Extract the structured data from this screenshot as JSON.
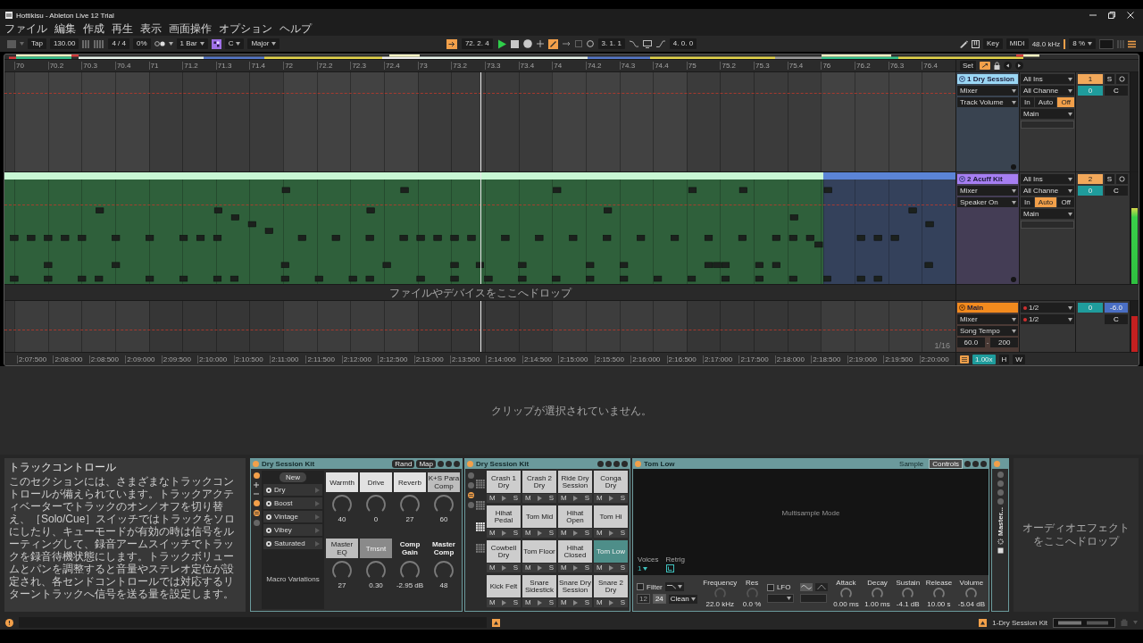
{
  "title_bar": {
    "title": "Hottikisu - Ableton Live 12 Trial"
  },
  "menu": [
    "ファイル",
    "編集",
    "作成",
    "再生",
    "表示",
    "画面操作",
    "オプション",
    "ヘルプ"
  ],
  "control_bar": {
    "tap": "Tap",
    "tempo": "130.00",
    "signature": "4 / 4",
    "groove": "0%",
    "quantize": "1 Bar",
    "key": "C",
    "scale": "Major",
    "position": "72. 2. 4",
    "playing": true,
    "loop_start": "3. 1. 1",
    "loop_length": "4. 0. 0",
    "key_map": "Key",
    "midi_map": "MIDI",
    "sample_rate": "48.0 kHz",
    "cpu": "8 %"
  },
  "ruler": {
    "bars": [
      "70",
      "70.2",
      "70.3",
      "70.4",
      "71",
      "71.2",
      "71.3",
      "71.4",
      "72",
      "72.2",
      "72.3",
      "72.4",
      "73",
      "73.2",
      "73.3",
      "73.4",
      "74",
      "74.2",
      "74.3",
      "74.4",
      "75",
      "75.2",
      "75.3",
      "75.4",
      "76",
      "76.2",
      "76.3",
      "76.4"
    ],
    "set": "Set"
  },
  "tracks": [
    {
      "name": "1 Dry Session",
      "color": "#9ad6f4",
      "device": "Mixer",
      "control": "Track Volume",
      "input": "All Ins",
      "channel": "All Channe",
      "monitor": [
        {
          "label": "In",
          "selected": false
        },
        {
          "label": "Auto",
          "selected": false
        },
        {
          "label": "Off",
          "selected": true
        }
      ],
      "output": "Main",
      "number": "1",
      "solo": "S",
      "volume": "0",
      "pan": "C"
    },
    {
      "name": "2 Acuff Kit",
      "color": "#a67ef2",
      "device": "Mixer",
      "control": "Speaker On",
      "input": "All Ins",
      "channel": "All Channe",
      "monitor": [
        {
          "label": "In",
          "selected": false
        },
        {
          "label": "Auto",
          "selected": true
        },
        {
          "label": "Off",
          "selected": false
        }
      ],
      "output": "Main",
      "number": "2",
      "solo": "S",
      "volume": "0",
      "pan": "C",
      "meter": {
        "level": 0.68
      },
      "clips": [
        {
          "color": "#c8f7d4"
        },
        {
          "color": "#5b84d6"
        }
      ]
    }
  ],
  "drop_zone": {
    "text": "ファイルやデバイスをここへドロップ"
  },
  "main_track": {
    "name": "Main",
    "device": "Mixer",
    "control": "Song Tempo",
    "range_min": "60.0",
    "range_sep": "-",
    "range_max": "200",
    "outputs": [
      "1/2",
      "1/2"
    ],
    "volume": "0",
    "cue": "-6.0",
    "pan": "C",
    "meter": {
      "level": 0.7
    }
  },
  "arrangement_footer": {
    "grid": "1/16",
    "times": [
      "2:07:500",
      "2:08:000",
      "2:08:500",
      "2:09:000",
      "2:09:500",
      "2:10:000",
      "2:10:500",
      "2:11:000",
      "2:11:500",
      "2:12:000",
      "2:12:500",
      "2:13:000",
      "2:13:500",
      "2:14:000",
      "2:14:500",
      "2:15:000",
      "2:15:500",
      "2:16:000",
      "2:16:500",
      "2:17:000",
      "2:17:500",
      "2:18:000",
      "2:18:500",
      "2:19:000",
      "2:19:500",
      "2:20:000"
    ],
    "zoom": "1.00x",
    "fit_height": "H",
    "fit_width": "W"
  },
  "detail_view": {
    "message": "クリップが選択されていません。"
  },
  "info_view": {
    "title": "トラックコントロール",
    "text": "このセクションには、さまざまなトラックコントロールが備えられています。トラックアクティベーターでトラックのオン／オフを切り替え、［Solo/Cue］スイッチではトラックをソロにしたり、キューモードが有効の時は信号をルーティングして、録音アームスイッチでトラックを録音待機状態にします。トラックボリュームとパンを調整すると音量やステレオ定位が設定され、各センドコントロールでは対応するリターントラックへ信号を送る量を設定します。"
  },
  "devices": {
    "macro_rack": {
      "name": "Dry Session Kit",
      "buttons": [
        "Rand",
        "Map"
      ],
      "new_label": "New",
      "variations": [
        "Dry",
        "Boost",
        "Vintage",
        "Vibey",
        "Saturated"
      ],
      "variations_label": "Macro Variations",
      "macros": [
        {
          "label": "Warmth",
          "value": "40",
          "kind": "light"
        },
        {
          "label": "Drive",
          "value": "0",
          "kind": "light"
        },
        {
          "label": "Reverb",
          "value": "27",
          "kind": "light"
        },
        {
          "label": "K+S Para Comp",
          "value": "60",
          "kind": "mid"
        },
        {
          "label": "Master EQ",
          "value": "27",
          "kind": "mid"
        },
        {
          "label": "Trnsnt",
          "value": "0.30",
          "kind": "dim"
        },
        {
          "label": "Comp Gain",
          "value": "-2.95 dB",
          "kind": "plain"
        },
        {
          "label": "Master Comp",
          "value": "48",
          "kind": "plain"
        }
      ]
    },
    "drum_rack": {
      "name": "Dry Session Kit",
      "pads": [
        {
          "name": "Crash 1 Dry",
          "mute": "M",
          "solo": "S",
          "selected": false
        },
        {
          "name": "Crash 2 Dry",
          "mute": "M",
          "solo": "S",
          "selected": false
        },
        {
          "name": "Ride Dry Session",
          "mute": "M",
          "solo": "S",
          "selected": false
        },
        {
          "name": "Conga Dry",
          "mute": "M",
          "solo": "S",
          "selected": false
        },
        {
          "name": "Hihat Pedal",
          "mute": "M",
          "solo": "S",
          "selected": false
        },
        {
          "name": "Tom Mid",
          "mute": "M",
          "solo": "S",
          "selected": false
        },
        {
          "name": "Hihat Open",
          "mute": "M",
          "solo": "S",
          "selected": false
        },
        {
          "name": "Tom Hi",
          "mute": "M",
          "solo": "S",
          "selected": false
        },
        {
          "name": "Cowbell Dry",
          "mute": "M",
          "solo": "S",
          "selected": false
        },
        {
          "name": "Tom Floor",
          "mute": "M",
          "solo": "S",
          "selected": false
        },
        {
          "name": "Hihat Closed",
          "mute": "M",
          "solo": "S",
          "selected": false
        },
        {
          "name": "Tom Low",
          "mute": "M",
          "solo": "S",
          "selected": true
        },
        {
          "name": "Kick Felt",
          "mute": "M",
          "solo": "S",
          "selected": false
        },
        {
          "name": "Snare Sidestick",
          "mute": "M",
          "solo": "S",
          "selected": false
        },
        {
          "name": "Snare Dry Session",
          "mute": "M",
          "solo": "S",
          "selected": false
        },
        {
          "name": "Snare 2 Dry",
          "mute": "M",
          "solo": "S",
          "selected": false
        }
      ]
    },
    "sampler": {
      "name": "Tom Low",
      "tabs": [
        {
          "label": "Sample",
          "selected": false
        },
        {
          "label": "Controls",
          "selected": true
        }
      ],
      "display": "Multisample Mode",
      "voices_label": "Voices",
      "voices": "1",
      "retrig_label": "Retrig",
      "retrig_on": true,
      "filter_on": false,
      "filter_label": "Filter",
      "slopes": [
        {
          "label": "12",
          "selected": false
        },
        {
          "label": "24",
          "selected": true
        }
      ],
      "filter_mode": "Clean",
      "filter_knobs": [
        {
          "label": "Frequency",
          "value": "22.0 kHz"
        },
        {
          "label": "Res",
          "value": "0.0 %"
        }
      ],
      "lfo_on": false,
      "lfo_label": "LFO",
      "envelope": [
        {
          "label": "Attack",
          "value": "0.00 ms"
        },
        {
          "label": "Decay",
          "value": "1.00 ms"
        },
        {
          "label": "Sustain",
          "value": "-4.1 dB"
        },
        {
          "label": "Release",
          "value": "10.00 s"
        },
        {
          "label": "Volume",
          "value": "-5.04 dB"
        }
      ]
    },
    "master_strip": {
      "name": "Master..."
    },
    "drop_hint": "オーディオエフェクトをここへドロップ"
  },
  "status_bar": {
    "selection": "1-Dry Session Kit"
  }
}
